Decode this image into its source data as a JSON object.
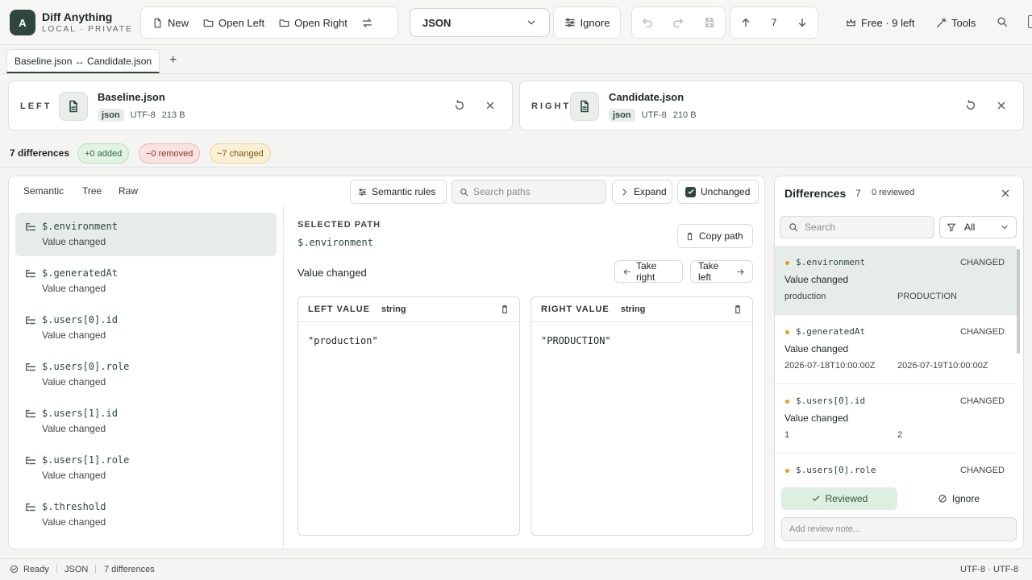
{
  "app": {
    "name": "Diff Anything",
    "tagline": "LOCAL · PRIVATE",
    "logo_letter": "A"
  },
  "toolbar": {
    "new": "New",
    "open_left": "Open Left",
    "open_right": "Open Right",
    "format": "JSON",
    "ignore": "Ignore",
    "nav_index": "7",
    "plan": "Free · 9 left",
    "tools": "Tools"
  },
  "tab": {
    "label": "Baseline.json ↔ Candidate.json"
  },
  "left_file": {
    "side": "LEFT",
    "name": "Baseline.json",
    "type": "json",
    "encoding": "UTF-8",
    "size": "213 B"
  },
  "right_file": {
    "side": "RIGHT",
    "name": "Candidate.json",
    "type": "json",
    "encoding": "UTF-8",
    "size": "210 B"
  },
  "summary": {
    "count": "7 differences",
    "added": "+0 added",
    "removed": "−0 removed",
    "changed": "~7 changed"
  },
  "modes": [
    "Semantic",
    "Tree",
    "Raw"
  ],
  "main_toolbar": {
    "semantic_rules": "Semantic rules",
    "search_placeholder": "Search paths",
    "expand": "Expand",
    "unchanged": "Unchanged"
  },
  "paths": [
    {
      "path": "$.environment",
      "desc": "Value changed"
    },
    {
      "path": "$.generatedAt",
      "desc": "Value changed"
    },
    {
      "path": "$.users[0].id",
      "desc": "Value changed"
    },
    {
      "path": "$.users[0].role",
      "desc": "Value changed"
    },
    {
      "path": "$.users[1].id",
      "desc": "Value changed"
    },
    {
      "path": "$.users[1].role",
      "desc": "Value changed"
    },
    {
      "path": "$.threshold",
      "desc": "Value changed"
    }
  ],
  "detail": {
    "selected_label": "SELECTED PATH",
    "selected_path": "$.environment",
    "copy": "Copy path",
    "change": "Value changed",
    "take_right": "Take right",
    "take_left": "Take left",
    "left_title": "LEFT VALUE",
    "left_type": "string",
    "left_value": "\"production\"",
    "right_title": "RIGHT VALUE",
    "right_type": "string",
    "right_value": "\"PRODUCTION\""
  },
  "differences": {
    "title": "Differences",
    "count": "7",
    "reviewed": "0 reviewed",
    "search_placeholder": "Search",
    "filter": "All",
    "items": [
      {
        "path": "$.environment",
        "kind": "CHANGED",
        "desc": "Value changed",
        "left": "production",
        "right": "PRODUCTION"
      },
      {
        "path": "$.generatedAt",
        "kind": "CHANGED",
        "desc": "Value changed",
        "left": "2026-07-18T10:00:00Z",
        "right": "2026-07-19T10:00:00Z"
      },
      {
        "path": "$.users[0].id",
        "kind": "CHANGED",
        "desc": "Value changed",
        "left": "1",
        "right": "2"
      },
      {
        "path": "$.users[0].role",
        "kind": "CHANGED",
        "desc": "",
        "left": "",
        "right": ""
      }
    ],
    "reviewed_btn": "Reviewed",
    "ignore_btn": "Ignore",
    "note_placeholder": "Add review note..."
  },
  "status": {
    "state": "Ready",
    "format": "JSON",
    "diffs": "7 differences",
    "encoding": "UTF-8 · UTF-8"
  }
}
